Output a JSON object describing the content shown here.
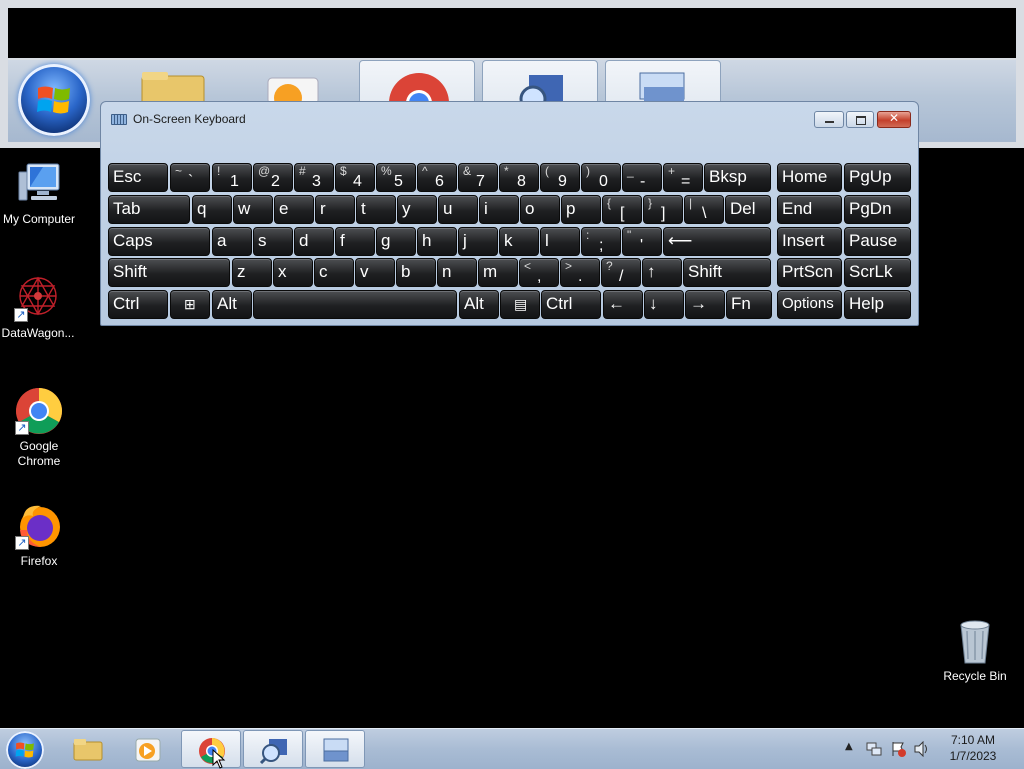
{
  "osk": {
    "title": "On-Screen Keyboard",
    "rows": [
      [
        {
          "id": "esc",
          "label": "Esc"
        },
        {
          "id": "backtick",
          "top": "~",
          "bottom": "`"
        },
        {
          "id": "1",
          "top": "!",
          "bottom": "1"
        },
        {
          "id": "2",
          "top": "@",
          "bottom": "2"
        },
        {
          "id": "3",
          "top": "#",
          "bottom": "3"
        },
        {
          "id": "4",
          "top": "$",
          "bottom": "4"
        },
        {
          "id": "5",
          "top": "%",
          "bottom": "5"
        },
        {
          "id": "6",
          "top": "^",
          "bottom": "6"
        },
        {
          "id": "7",
          "top": "&",
          "bottom": "7"
        },
        {
          "id": "8",
          "top": "*",
          "bottom": "8"
        },
        {
          "id": "9",
          "top": "(",
          "bottom": "9"
        },
        {
          "id": "0",
          "top": ")",
          "bottom": "0"
        },
        {
          "id": "minus",
          "top": "_",
          "bottom": "-"
        },
        {
          "id": "equals",
          "top": "+",
          "bottom": "="
        },
        {
          "id": "bksp",
          "label": "Bksp"
        },
        {
          "id": "home",
          "label": "Home"
        },
        {
          "id": "pgup",
          "label": "PgUp"
        }
      ],
      [
        {
          "id": "tab",
          "label": "Tab"
        },
        {
          "id": "q",
          "label": "q"
        },
        {
          "id": "w",
          "label": "w"
        },
        {
          "id": "e",
          "label": "e"
        },
        {
          "id": "r",
          "label": "r"
        },
        {
          "id": "t",
          "label": "t"
        },
        {
          "id": "y",
          "label": "y"
        },
        {
          "id": "u",
          "label": "u"
        },
        {
          "id": "i",
          "label": "i"
        },
        {
          "id": "o",
          "label": "o"
        },
        {
          "id": "p",
          "label": "p"
        },
        {
          "id": "lbracket",
          "top": "{",
          "bottom": "["
        },
        {
          "id": "rbracket",
          "top": "}",
          "bottom": "]"
        },
        {
          "id": "backslash",
          "top": "|",
          "bottom": "\\"
        },
        {
          "id": "del",
          "label": "Del"
        },
        {
          "id": "end",
          "label": "End"
        },
        {
          "id": "pgdn",
          "label": "PgDn"
        }
      ],
      [
        {
          "id": "caps",
          "label": "Caps"
        },
        {
          "id": "a",
          "label": "a"
        },
        {
          "id": "s",
          "label": "s"
        },
        {
          "id": "d",
          "label": "d"
        },
        {
          "id": "f",
          "label": "f"
        },
        {
          "id": "g",
          "label": "g"
        },
        {
          "id": "h",
          "label": "h"
        },
        {
          "id": "j",
          "label": "j"
        },
        {
          "id": "k",
          "label": "k"
        },
        {
          "id": "l",
          "label": "l"
        },
        {
          "id": "semicolon",
          "top": ":",
          "bottom": ";"
        },
        {
          "id": "quote",
          "top": "\"",
          "bottom": "'"
        },
        {
          "id": "enter",
          "label": "⟵"
        },
        {
          "id": "insert",
          "label": "Insert"
        },
        {
          "id": "pause",
          "label": "Pause"
        }
      ],
      [
        {
          "id": "lshift",
          "label": "Shift"
        },
        {
          "id": "z",
          "label": "z"
        },
        {
          "id": "x",
          "label": "x"
        },
        {
          "id": "c",
          "label": "c"
        },
        {
          "id": "v",
          "label": "v"
        },
        {
          "id": "b",
          "label": "b"
        },
        {
          "id": "n",
          "label": "n"
        },
        {
          "id": "m",
          "label": "m"
        },
        {
          "id": "comma",
          "top": "<",
          "bottom": ","
        },
        {
          "id": "period",
          "top": ">",
          "bottom": "."
        },
        {
          "id": "slash",
          "top": "?",
          "bottom": "/"
        },
        {
          "id": "up",
          "label": "↑"
        },
        {
          "id": "rshift",
          "label": "Shift"
        },
        {
          "id": "prtscn",
          "label": "PrtScn"
        },
        {
          "id": "scrlk",
          "label": "ScrLk"
        }
      ],
      [
        {
          "id": "lctrl",
          "label": "Ctrl"
        },
        {
          "id": "win",
          "label": "⊞"
        },
        {
          "id": "lalt",
          "label": "Alt"
        },
        {
          "id": "space",
          "label": ""
        },
        {
          "id": "ralt",
          "label": "Alt"
        },
        {
          "id": "menu",
          "label": "▤"
        },
        {
          "id": "rctrl",
          "label": "Ctrl"
        },
        {
          "id": "left",
          "label": "←"
        },
        {
          "id": "down",
          "label": "↓"
        },
        {
          "id": "right",
          "label": "→"
        },
        {
          "id": "fn",
          "label": "Fn"
        },
        {
          "id": "options",
          "label": "Options"
        },
        {
          "id": "help",
          "label": "Help"
        }
      ]
    ]
  },
  "desktop": {
    "icons": [
      {
        "name": "my-computer",
        "label": "My Computer"
      },
      {
        "name": "datawagon",
        "label": "DataWagon..."
      },
      {
        "name": "google-chrome",
        "label": "Google Chrome"
      },
      {
        "name": "firefox",
        "label": "Firefox"
      },
      {
        "name": "recycle-bin",
        "label": "Recycle Bin"
      }
    ]
  },
  "taskbar": {
    "clock_time": "7:10 AM",
    "clock_date": "1/7/2023",
    "buttons": [
      "start-orb-icon",
      "explorer-icon",
      "media-player-icon",
      "chrome-icon",
      "magnifier-icon",
      "on-screen-keyboard-icon"
    ]
  },
  "colors": {
    "desktop_bg": "#000000",
    "key_bg": "#1f2022",
    "window_frame": "#b6c9e0",
    "close_button": "#c4412c"
  }
}
